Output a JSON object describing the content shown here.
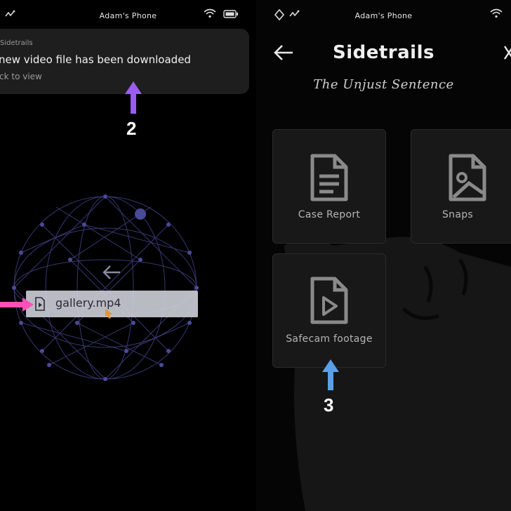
{
  "left": {
    "status": {
      "carrier": "Adam's Phone"
    },
    "notification": {
      "app": "Sidetrails",
      "message": "new video file has been downloaded",
      "hint": "ck to view"
    },
    "step_number": "2",
    "file": {
      "name": "gallery.mp4"
    }
  },
  "right": {
    "status": {
      "carrier": "Adam's Phone"
    },
    "title": "Sidetrails",
    "subtitle": "The Unjust Sentence",
    "cards": [
      {
        "label": "Case Report",
        "icon": "document-icon"
      },
      {
        "label": "Snaps",
        "icon": "image-icon"
      },
      {
        "label": "Safecam footage",
        "icon": "video-file-icon"
      }
    ],
    "step_number": "3"
  },
  "colors": {
    "arrow_purple": "#9a5cf0",
    "arrow_pink": "#ff4fb8",
    "arrow_blue": "#5aa0e6",
    "globe_lines": "#3a3a78",
    "cursor_orange": "#f2a23a"
  }
}
